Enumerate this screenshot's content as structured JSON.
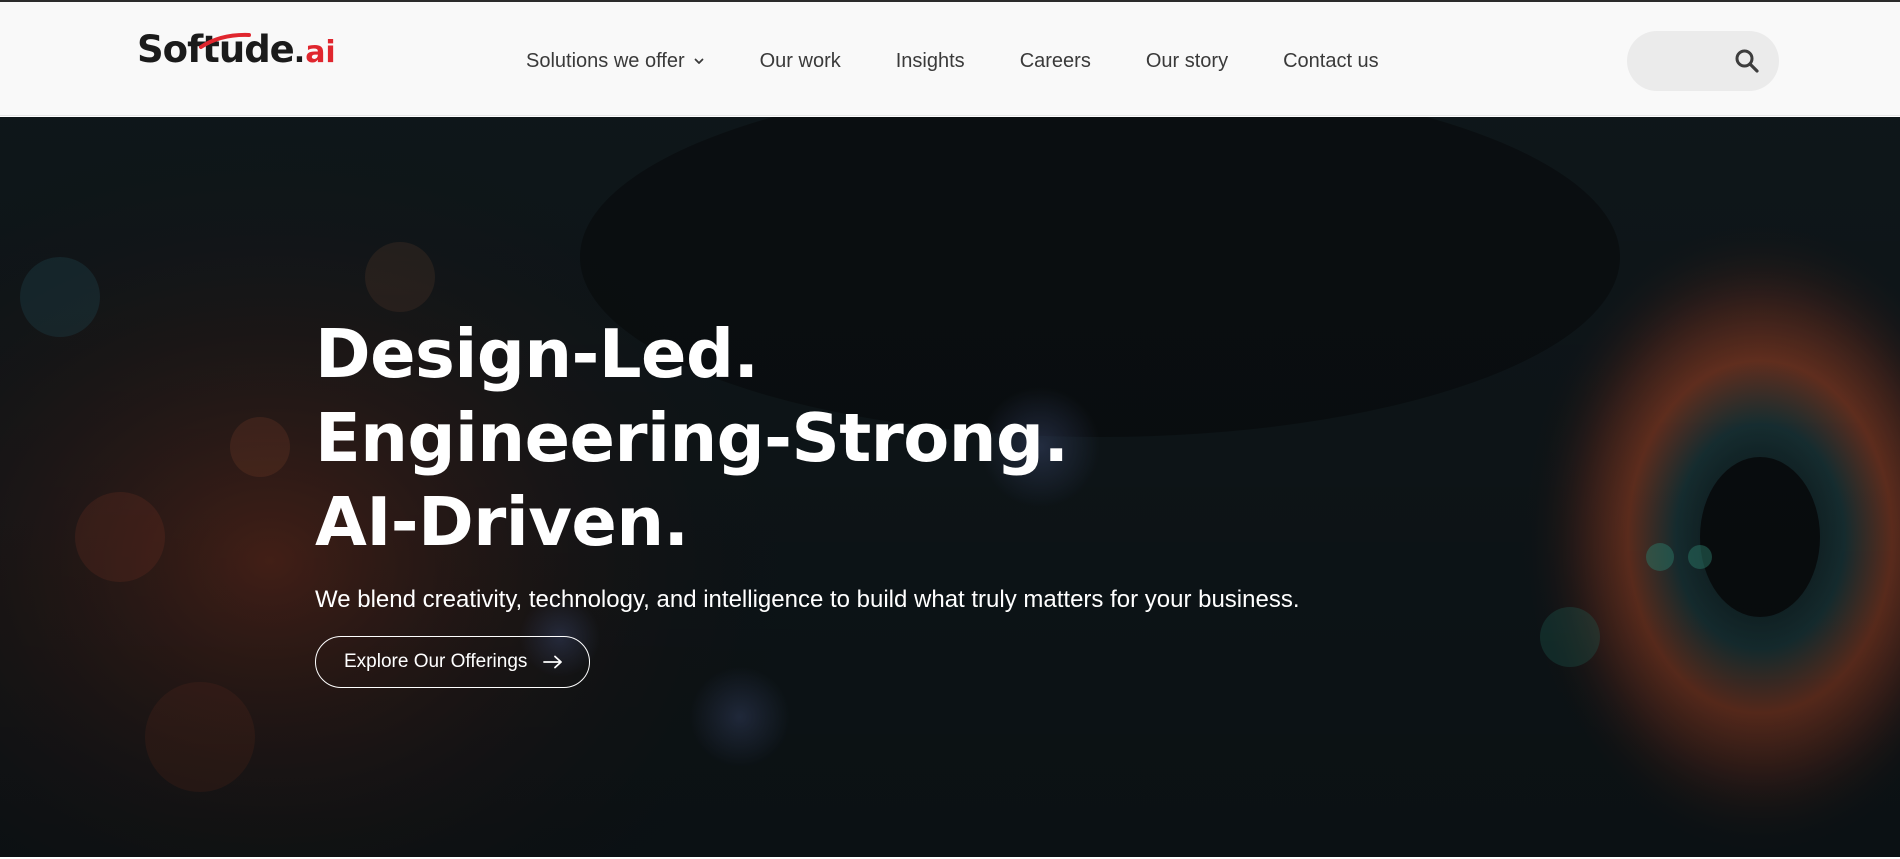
{
  "header": {
    "logo": {
      "main": "Softude",
      "dot": ".",
      "ai": "ai"
    },
    "nav": [
      {
        "label": "Solutions we offer",
        "has_dropdown": true
      },
      {
        "label": "Our work"
      },
      {
        "label": "Insights"
      },
      {
        "label": "Careers"
      },
      {
        "label": "Our story"
      },
      {
        "label": "Contact us"
      }
    ],
    "search": {
      "placeholder": "",
      "icon": "search-icon"
    }
  },
  "hero": {
    "title_lines": [
      "Design-Led.",
      "Engineering-Strong.",
      "AI-Driven."
    ],
    "subtitle": "We blend creativity, technology, and intelligence to build what truly matters for your business.",
    "cta_label": "Explore Our Offerings",
    "cta_icon": "arrow-right-icon"
  },
  "colors": {
    "brand_red": "#e0262e",
    "header_bg": "#f9f9f9",
    "hero_bg": "#0d1418",
    "text_dark": "#1b1b1b"
  }
}
